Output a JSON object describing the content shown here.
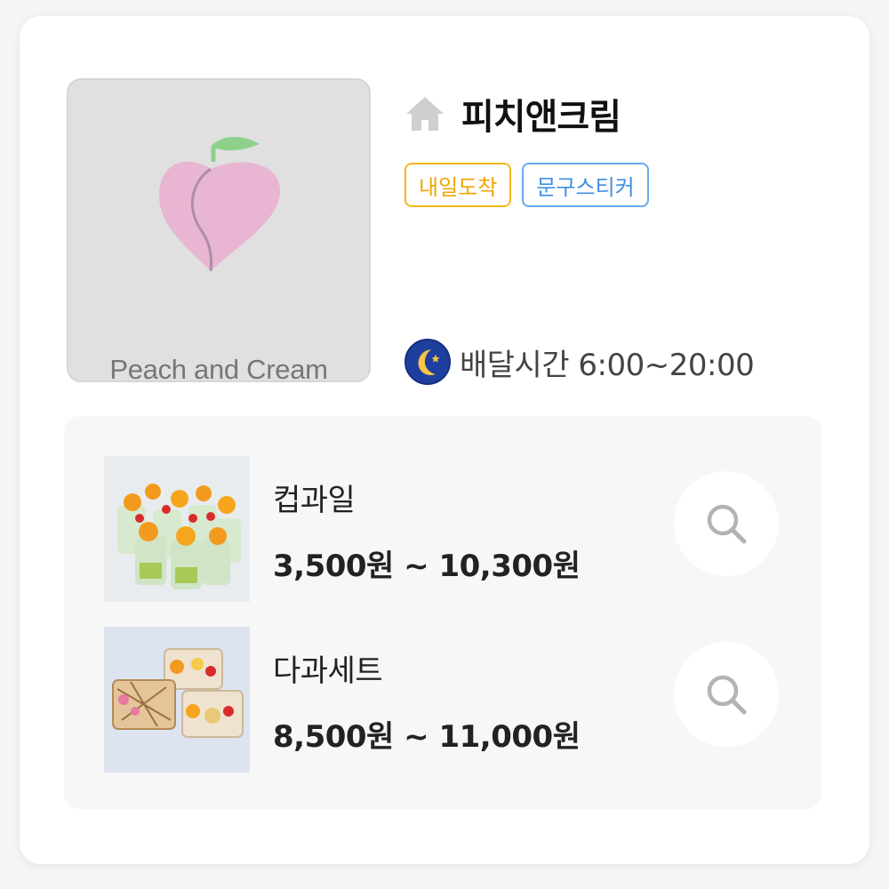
{
  "store": {
    "name": "피치앤크림",
    "logo_text": "Peach and Cream",
    "home_icon": "home-icon",
    "tags": [
      {
        "label": "내일도착",
        "color": "#f0a500"
      },
      {
        "label": "문구스티커",
        "color": "#3f8fe6"
      }
    ],
    "delivery_icon": "moon-icon",
    "delivery_text": "배달시간 6:00~20:00"
  },
  "products": [
    {
      "name": "컵과일",
      "price": "3,500원 ~ 10,300원",
      "image": "fruit-cups-image",
      "action_icon": "search-icon"
    },
    {
      "name": "다과세트",
      "price": "8,500원 ~ 11,000원",
      "image": "snack-set-image",
      "action_icon": "search-icon"
    }
  ],
  "colors": {
    "accent_yellow": "#f5b71a",
    "accent_blue": "#6aa8ee",
    "peach": "#e8b6d2",
    "leaf": "#8ed08a"
  }
}
